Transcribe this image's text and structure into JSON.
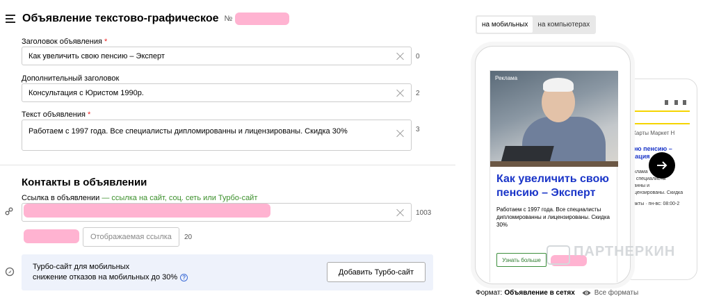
{
  "editor": {
    "title": "Объявление текстово-графическое",
    "number_label": "№",
    "fields": {
      "headline": {
        "label": "Заголовок объявления",
        "required": "*",
        "value": "Как увеличить свою пенсию – Эксперт",
        "counter": "0"
      },
      "subheadline": {
        "label": "Дополнительный заголовок",
        "value": "Консультация с Юристом 1990р.",
        "counter": "2"
      },
      "text": {
        "label": "Текст объявления",
        "required": "*",
        "value": "Работаем с 1997 года. Все специалисты дипломированны и лицензированы. Скидка 30%",
        "counter": "3"
      }
    },
    "contacts": {
      "title": "Контакты в объявлении",
      "link_label": "Ссылка в объявлении",
      "link_hint": "— ссылка на сайт, соц. сеть или Турбо-сайт",
      "link_counter": "1003",
      "display_link_placeholder": "Отображаемая ссылка",
      "display_link_counter": "20"
    },
    "turbo": {
      "title": "Турбо-сайт для мобильных",
      "subtitle": "снижение отказов на мобильных до 30%",
      "help": "?",
      "button": "Добавить Турбо-сайт"
    }
  },
  "preview": {
    "tabs": [
      {
        "label": "на мобильных",
        "active": true
      },
      {
        "label": "на компьютерах",
        "active": false
      }
    ],
    "ad": {
      "label": "Реклама",
      "title": "Как увеличить свою пенсию – Эксперт",
      "text": "Работаем с 1997 года. Все специалисты дипломированны и лицензированы. Скидка 30%",
      "button": "Узнать больше"
    },
    "back_phone": {
      "nav": "с   Карты   Маркет   Н",
      "title_line1": "вою пенсию –",
      "title_line2": "ьтация",
      "line1": "реклама",
      "line2": "ые специалисты",
      "line3": "ованны и",
      "line4": "лицензированы. Скидка",
      "contacts": "нтакты · пн-вс: 08:00-2"
    },
    "watermark": "ПАРТНЕРКИН",
    "format_label": "Формат:",
    "format_value": "Объявление в сетях",
    "all_formats": "Все форматы"
  },
  "colors": {
    "ad_title": "#1a35c8",
    "link_hint": "#3a8f2a",
    "turbo_bg": "#eef2fb",
    "redaction": "#ffb3d1",
    "search_bar": "#f5d400"
  }
}
